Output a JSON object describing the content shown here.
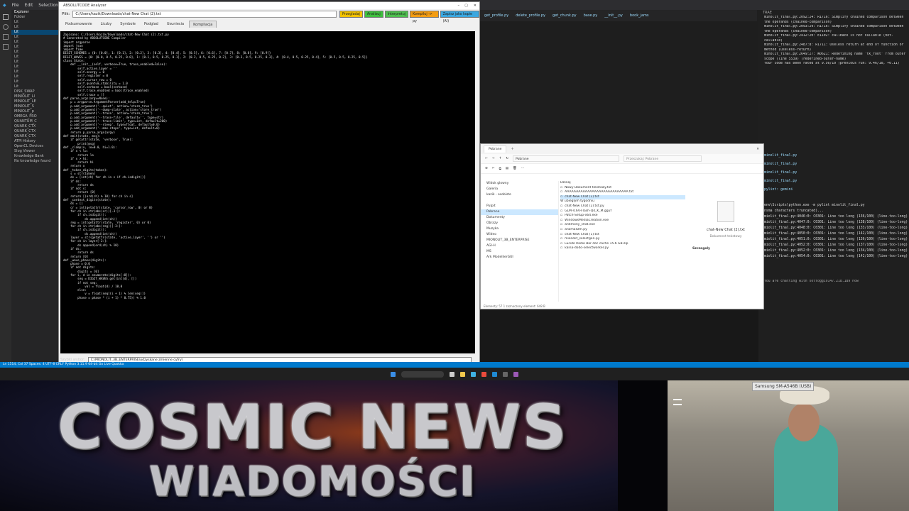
{
  "vscode": {
    "menu": [
      "File",
      "Edit",
      "Selection"
    ],
    "explorer_title": "Explorer",
    "explorer_items": [
      "Folder",
      "Lit",
      "Lit",
      "Lit",
      "Lit",
      "Lit",
      "Lit",
      "Lit",
      "Lit",
      "Lit",
      "Lit",
      "Lit",
      "Lit",
      "Lit",
      "Lit",
      "DISK_SWAP",
      "MINIOLIT_LI",
      "MINIOLIT_LE",
      "MINIOLIT_S",
      "MINIOLIT_p",
      "OMEGA_PRO",
      "QUANTUM_C",
      "QUARK_CTX",
      "QUARK_CTX",
      "QUARK_CTX",
      "ATPI History",
      "OpenCL Devices",
      "Slog Viewer",
      "Knowledge Bank",
      "No knowledge found"
    ],
    "editor_tabs": [
      "get_profile.py",
      "delete_profile.py",
      "get_chunk.py",
      "base.py",
      "__init__.py",
      "book_jams"
    ],
    "right_panel_lines": [
      "minolit_final.py:2092:24: R1716: Simplify chained comparison between",
      "the operands (chained-comparison)",
      "minolit_final.py:2093:29: R1716: Simplify chained comparison between",
      "the operands (chained-comparison)",
      "minolit_final.py:2412:20: E1102: callback is not callable (not-",
      "callable)",
      "minolit_final.py:2487:8: R1711: Useless return at end of function or",
      "method (useless-return)",
      "minolit_final.py:2649:27: W0621: Redefining name 'tk_root' from outer",
      "scope (line 5539) (redefined-outer-name)",
      "",
      "Your code has been rated at 9.56/10 (previous run: 9.46/10, +0.11)"
    ],
    "right_files": [
      "minolit_final.py",
      "minolit_final.py",
      "minolit_final.py",
      "minolit_final.py",
      "pylint: gemini"
    ],
    "right_term": [
      "env\\Scripts\\python.exe -m pylint minolit_final.py",
      "nsma characters truncated)...",
      "miolit_final.py:4046:0: C0301: Line too long (136/100) (line-too-long)",
      "miolit_final.py:4047:0: C0301: Line too long (138/100) (line-too-long)",
      "miolit_final.py:4048:0: C0301: Line too long (133/100) (line-too-long)",
      "miolit_final.py:4050:0: C0301: Line too long (142/100) (line-too-long)",
      "miolit_final.py:4051:0: C0301: Line too long (136/100) (line-too-long)",
      "miolit_final.py:4052:0: C0301: Line too long (137/100) (line-too-long)",
      "miolit_final.py:4052:0: C0301: Line too long (134/100) (line-too-long)",
      "miolit_final.py:4054:0: C0301: Line too long (142/100) (line-too-long)"
    ],
    "chat_note": "You are chatting with sottoggio147.218.189 now",
    "status_text": "Ln 1514, Col 37   Spaces: 4   UTF-8   CRLF   Python   3.11.9 64-bit   Go Live   Quokka"
  },
  "analyzer": {
    "title": "ABSOLUTCODE Analyzer",
    "file_label": "Plik:",
    "file_path": "C:/Users/kazik/Downloads/chat-New Chat (2).txt",
    "buttons": [
      {
        "label": "Przegladaj",
        "color": "#f2c200"
      },
      {
        "label": "Analizuj",
        "color": "#3fbf3f"
      },
      {
        "label": "Interpretuj",
        "color": "#4fc04f"
      },
      {
        "label": "Kompiluj -> py",
        "color": "#f39c12"
      },
      {
        "label": "Zapisz jako kopie (AI)",
        "color": "#3ba7e0"
      }
    ],
    "tabs": [
      "Podsumowanie",
      "Liczby",
      "Symbole",
      "Podglad",
      "Usuniecia",
      "Kompilacja"
    ],
    "active_tab": "Kompilacja",
    "search_label": "Szybki wybor:",
    "search_value": "C:\\MIONOLIT_3B_ENTERPRISE\\odzyskane zmienne cyfry\\"
  },
  "code_lines": [
    "Zapisano: C:/Users/kazik/Downloads/chat-New Chat (2).txt.py",
    "",
    "# Generated by ABSOLUTCODE Compiler",
    "import argparse",
    "import json",
    "import time",
    "",
    "DIGIT_SCHEMES = {0: [0.0], 1: [0.1], 2: [0.2], 3: [0.3], 4: [0.4], 5: [0.5], 6: [0.6], 7: [0.7], 8: [0.8], 9: [0.9]}",
    "DIGIT_WAVES = {0: [0.0, 0.5, 0.25, 0.0], 1: [0.1, 0.5, 0.25, 0.1], 2: [0.2, 0.5, 0.25, 0.2], 3: [0.3, 0.5, 0.25, 0.3], 4: [0.4, 0.5, 0.25, 0.4], 5: [0.5, 0.5, 0.25, 0.5]}",
    "",
    "class State:",
    "    def __init__(self, verbose=True, trace_enabled=False):",
    "        self.active_layer = ''",
    "        self.energy = 0",
    "        self.register = 0",
    "        self.cursor_row = 0",
    "        self.quantum_stability = 1.0",
    "        self.verbose = bool(verbose)",
    "        self.trace_enabled = bool(trace_enabled)",
    "        self.trace = []",
    "",
    "def parse_args(argv=None):",
    "    p = argparse.ArgumentParser(add_help=True)",
    "    p.add_argument('--quiet', action='store_true')",
    "    p.add_argument('--dump-state', action='store_true')",
    "    p.add_argument('--trace', action='store_true')",
    "    p.add_argument('--trace-file', default='', type=str)",
    "    p.add_argument('--trace-limit', type=int, default=200)",
    "    p.add_argument('--sleep', type=float, default=0.0)",
    "    p.add_argument('--max-steps', type=int, default=0)",
    "    return p.parse_args(argv)",
    "",
    "def emit(state, msg):",
    "    if getattr(state, 'verbose', True):",
    "        print(msg)",
    "",
    "def _clamp(x, lo=0.0, hi=1.0):",
    "    if x < lo:",
    "        return lo",
    "    if x > hi:",
    "        return hi",
    "    return x",
    "",
    "def _token_digits(token):",
    "    s = str(token)",
    "    ds = [int(ch) for ch in s if ch.isdigit()]",
    "    if ds:",
    "        return ds",
    "    if not s:",
    "        return [0]",
    "    return [(ord(ch) % 10) for ch in s]",
    "",
    "def _context_digits(state):",
    "    ds = []",
    "    cr = int(getattr(state, 'cursor_row', 0) or 0)",
    "    for ch in str(abs(cr))[-3:]:",
    "        if ch.isdigit():",
    "            ds.append(int(ch))",
    "    reg = int(getattr(state, 'register', 0) or 0)",
    "    for ch in str(abs(reg))[-3:]:",
    "        if ch.isdigit():",
    "            ds.append(int(ch))",
    "    layer = str(getattr(state, 'active_layer', '') or '')",
    "    for ch in layer[-2:]:",
    "        ds.append(ord(ch) % 10)",
    "    if ds:",
    "        return ds",
    "    return [0]",
    "",
    "def _wave_phase(digits):",
    "    phase = 0.0",
    "    if not digits:",
    "        digits = [0]",
    "    for i, d in enumerate(digits[:8]):",
    "        seq = DIGIT_WAVES.get(int(d), [])",
    "        if not seq:",
    "            val = float(d) / 10.0",
    "        else:",
    "            v = float(seq[(i + 1) % len(seq)])",
    "        phase = phase * (i + 1) * 0.75)) % 1.0"
  ],
  "file_explorer": {
    "tab": "Pobrane",
    "address": "Pobrane",
    "search_placeholder": "Przeszukaj: Pobrane",
    "nav": [
      "Widok glowny",
      "Galeria",
      "kazik - osobiste",
      "",
      "Pulpit",
      "Pobrane",
      "Dokumenty",
      "Obrazy",
      "Muzyka",
      "Wideo",
      "MIONOLIT_3B_ENTERPRISE",
      "AGI-H",
      "MS",
      "Ark ModellierGUI"
    ],
    "group_today": "Dzisiaj",
    "group_earlier": "W ubieglym tygodniu",
    "files": [
      "Nowy Dokument tekstowy.txt",
      "AAAAAAAAAAAAAAAAAAAAAAAAAAAA.txt",
      "chat-New Chat (2).txt",
      "chat-New Chat (2).txt.py",
      "GLM-4.6V-Flash-Q4_K_M.gguf",
      "Patch-Setup-x64.exe",
      "WindowsMediaCreation.exe",
      "antimony_chat.exe",
      "anomalizm.py",
      "chat-New Chat (1).txt",
      "mionolit_selectgen.py",
      "Lucide Radio Bar doc cache 15.6 GB.zip",
      "kaina-dodo-selectworker.py"
    ],
    "preview_name": "chat-New Chat (2).txt",
    "preview_type": "Dokument tekstowy",
    "details_title": "Szczegoly",
    "status": "Elementy: 57   1 zaznaczony element: 648 B"
  },
  "banner": {
    "line1": "COSMIC NEWS",
    "line2": "WIADOMOŚCI"
  },
  "camera": {
    "label": "Samsung SM-A546B (USB)"
  }
}
